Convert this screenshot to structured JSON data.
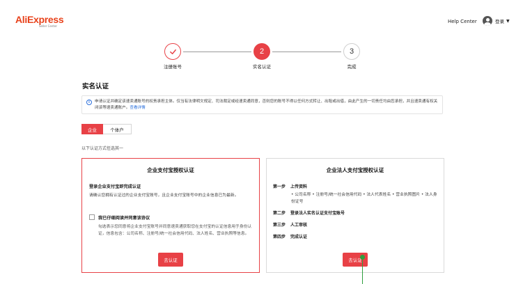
{
  "header": {
    "logo": "AliExpress",
    "logo_sub": "Seller Center",
    "help": "Help Center",
    "login": "登录"
  },
  "steps": [
    {
      "index": "",
      "label": "注册账号",
      "state": "done"
    },
    {
      "index": "2",
      "label": "实名认证",
      "state": "current"
    },
    {
      "index": "3",
      "label": "完成",
      "state": "pending"
    }
  ],
  "page": {
    "title": "实名认证",
    "notice": "申请认证并确定该速卖通账号的权责承担主体。仅当有法律明文规定、司法裁定或经速卖通同意，否则您的账号不得以任何方式转让、出租或出借，由此产生的一切责任均由您承担，并且速卖通有权关闭该等速卖通账户。",
    "notice_link": "查看详情",
    "tabs": [
      "企业",
      "个体户"
    ],
    "hint": "以下认证方式任选其一"
  },
  "cards": {
    "alipay": {
      "title": "企业支付宝授权认证",
      "subtitle": "登录企业支付宝即完成认证",
      "desc": "请确认您拥有认证过的企业支付宝账号，且企业支付宝账号中的企业信息已为最新。",
      "agree_label": "我已仔细阅读并同意该协议",
      "agree_desc": "勾选表示您同意将企业支付宝账号并同意速卖通获取您在支付宝的认证信息用于身份认证，信息包含：公司名称、注册号/统一社会信用代码、法人姓名、营业执照等信息。",
      "button": "去认证"
    },
    "legal": {
      "title": "企业法人支付宝授权认证",
      "steps": [
        {
          "no": "第一步",
          "text": "上传资料"
        },
        {
          "no": "第二步",
          "text": "登录法人实名认证支付宝账号"
        },
        {
          "no": "第三步",
          "text": "人工审核"
        },
        {
          "no": "第四步",
          "text": "完成认证"
        }
      ],
      "bullets": "• 公司名称  • 注册号/统一社会信用代码  • 法人代表姓名  • 营业执照图片  • 法人身份证号",
      "button": "去认证"
    }
  },
  "colors": {
    "accent": "#e84146",
    "link": "#2a6fdb",
    "logo": "#e8421b"
  },
  "icons": {
    "info": "info-icon",
    "check": "check-icon",
    "avatar": "avatar-icon",
    "caret": "chevron-down-icon"
  }
}
